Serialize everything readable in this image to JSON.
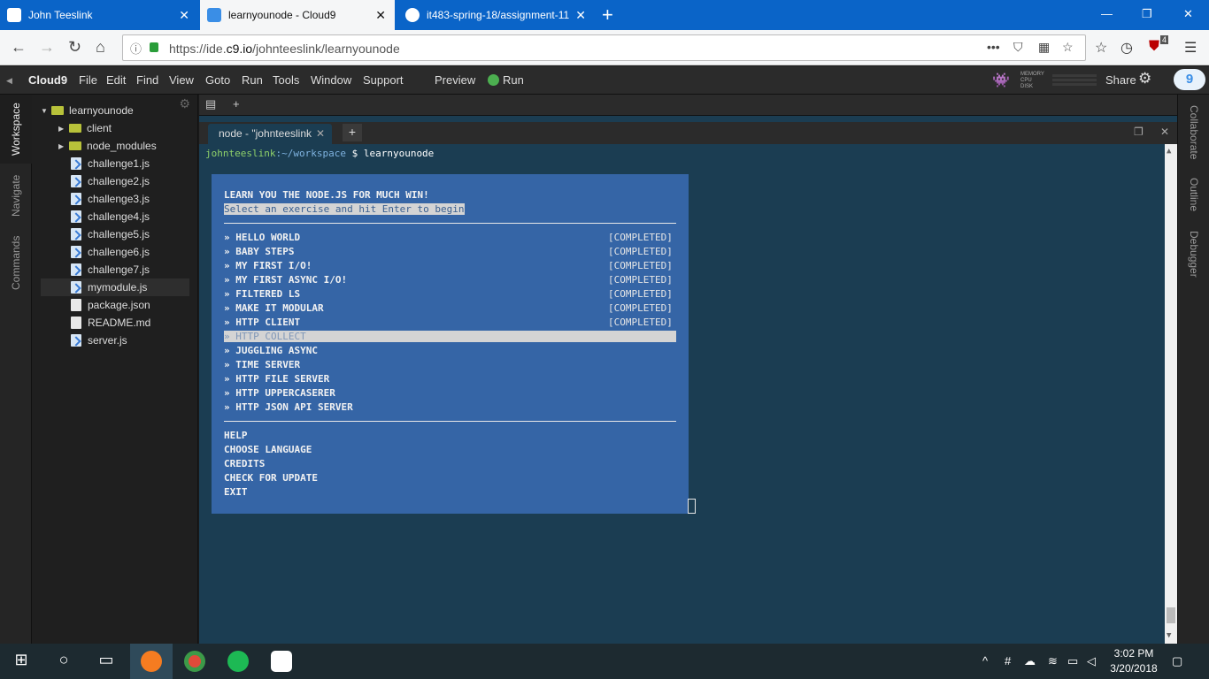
{
  "browser": {
    "tabs": [
      {
        "label": "John Teeslink"
      },
      {
        "label": "learnyounode - Cloud9"
      },
      {
        "label": "it483-spring-18/assignment-11"
      }
    ],
    "url_prefix": "https://ide.",
    "url_domain": "c9.io",
    "url_path": "/johnteeslink/learnyounode",
    "badge": "4"
  },
  "c9": {
    "menu": [
      "Cloud9",
      "File",
      "Edit",
      "Find",
      "View",
      "Goto",
      "Run",
      "Tools",
      "Window",
      "Support"
    ],
    "preview": "Preview",
    "run": "Run",
    "share": "Share",
    "stats": [
      "MEMORY",
      "CPU",
      "DISK"
    ]
  },
  "left_tabs": [
    "Workspace",
    "Navigate",
    "Commands"
  ],
  "right_tabs": [
    "Collaborate",
    "Outline",
    "Debugger"
  ],
  "tree": {
    "root": "learnyounode",
    "folders": [
      "client",
      "node_modules"
    ],
    "files": [
      "challenge1.js",
      "challenge2.js",
      "challenge3.js",
      "challenge4.js",
      "challenge5.js",
      "challenge6.js",
      "challenge7.js",
      "mymodule.js",
      "package.json",
      "README.md",
      "server.js"
    ]
  },
  "terminal": {
    "tab_label": "node - \"johnteeslink",
    "prompt_user": "johnteeslink",
    "prompt_path": ":~/workspace",
    "prompt_cmd": " $ learnyounode",
    "title": "LEARN YOU THE NODE.JS FOR MUCH WIN!",
    "subtitle": "Select an exercise and hit Enter to begin",
    "exercises": [
      "» HELLO WORLD",
      "» BABY STEPS",
      "» MY FIRST I/O!",
      "» MY FIRST ASYNC I/O!",
      "» FILTERED LS",
      "» MAKE IT MODULAR",
      "» HTTP CLIENT",
      "» HTTP COLLECT",
      "» JUGGLING ASYNC",
      "» TIME SERVER",
      "» HTTP FILE SERVER",
      "» HTTP UPPERCASERER",
      "» HTTP JSON API SERVER"
    ],
    "completed_label": "[COMPLETED]",
    "options": [
      "HELP",
      "CHOOSE LANGUAGE",
      "CREDITS",
      "CHECK FOR UPDATE",
      "EXIT"
    ]
  },
  "taskbar": {
    "time": "3:02 PM",
    "date": "3/20/2018"
  }
}
